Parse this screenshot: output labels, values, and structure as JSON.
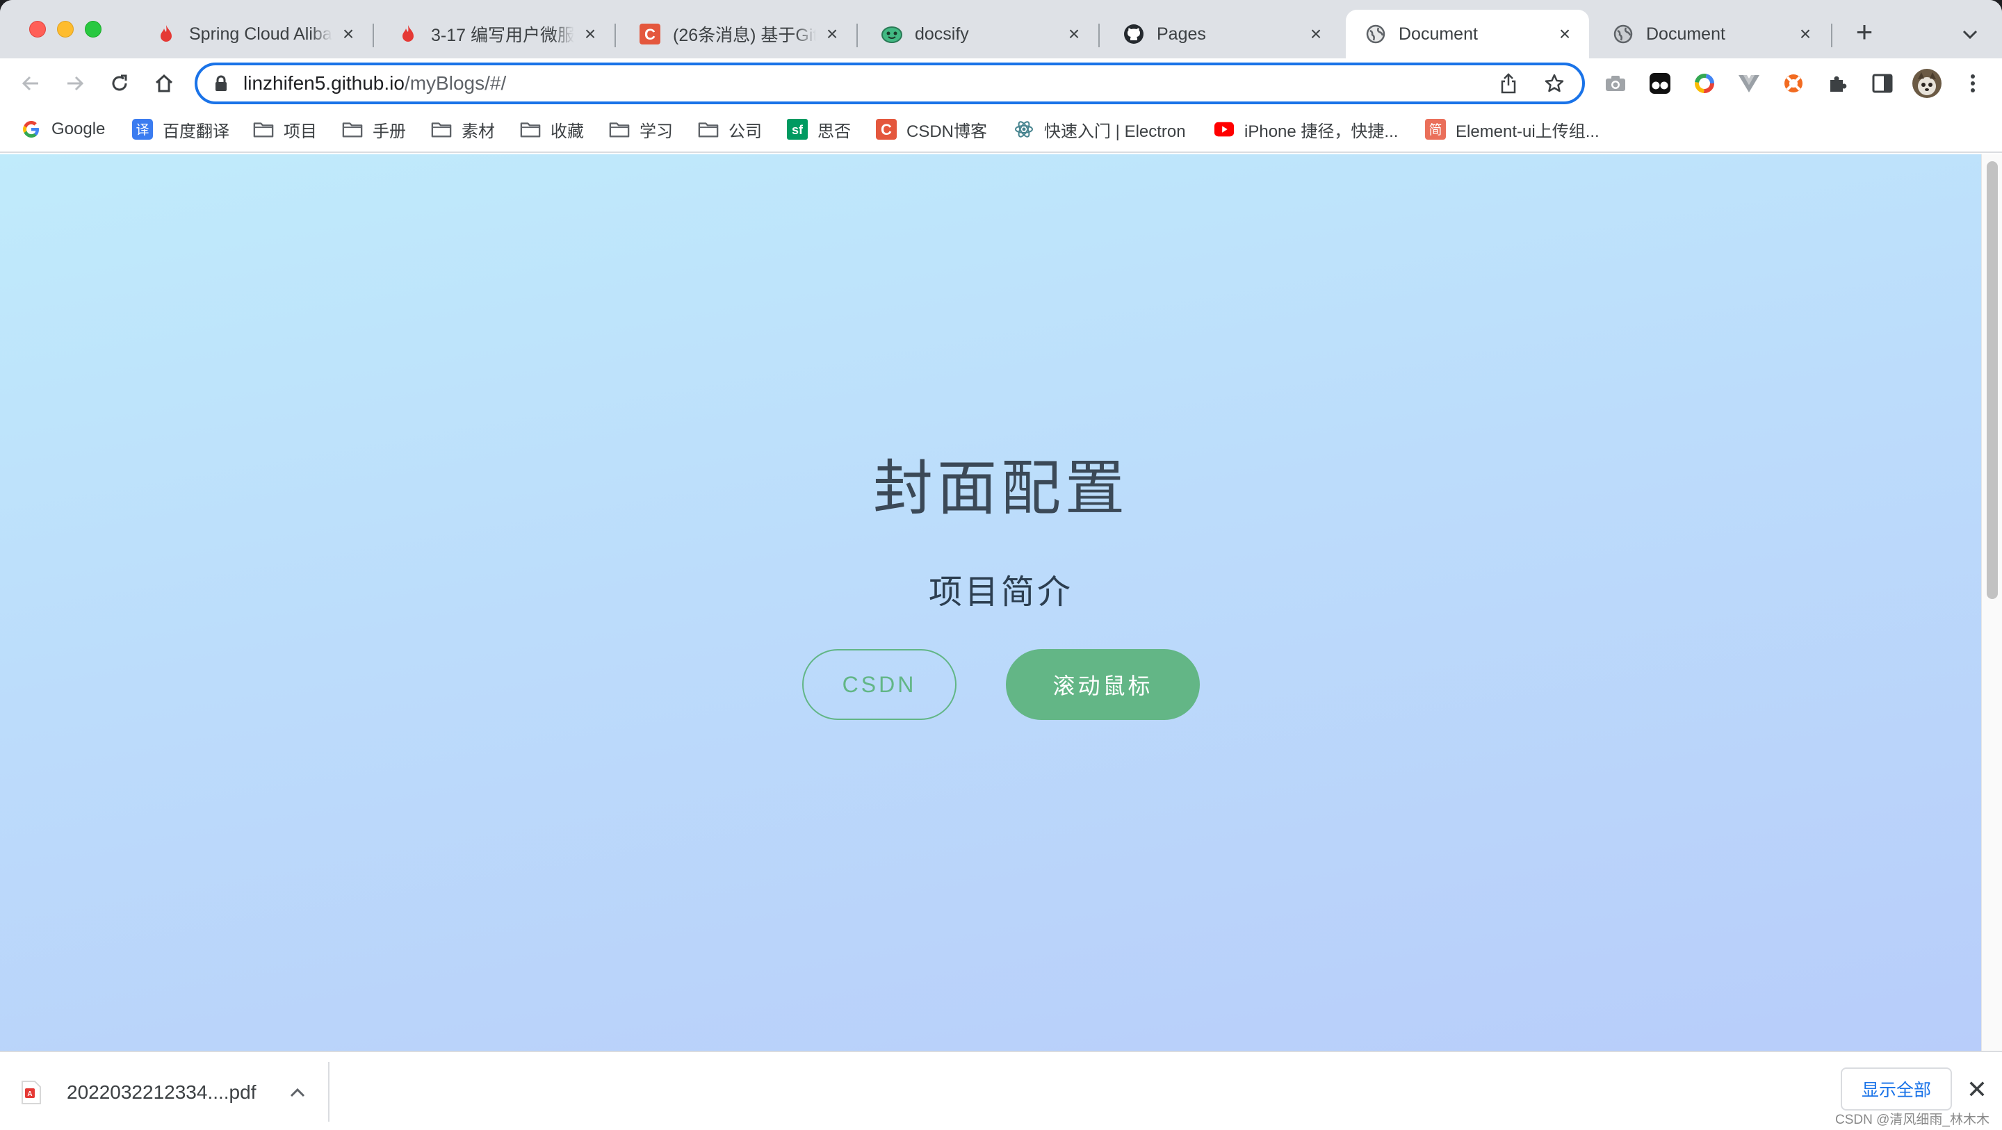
{
  "browser": {
    "tabs": [
      {
        "title": "Spring Cloud Alibaba",
        "icon": "flame-icon",
        "active": false
      },
      {
        "title": "3-17 编写用户微服务",
        "icon": "flame-icon",
        "active": false
      },
      {
        "title": "(26条消息) 基于Github",
        "icon": "csdn-icon",
        "active": false
      },
      {
        "title": "docsify",
        "icon": "docsify-icon",
        "active": false
      },
      {
        "title": "Pages",
        "icon": "github-icon",
        "active": false
      },
      {
        "title": "Document",
        "icon": "globe-icon",
        "active": true
      },
      {
        "title": "Document",
        "icon": "globe-icon",
        "active": false
      }
    ],
    "new_tab_label": "+",
    "address": {
      "host": "linzhifen5.github.io",
      "path": "/myBlogs/#/"
    },
    "bookmarks": [
      {
        "label": "Google",
        "icon": "google-icon"
      },
      {
        "label": "百度翻译",
        "icon": "translate-icon"
      },
      {
        "label": "项目",
        "icon": "folder-icon"
      },
      {
        "label": "手册",
        "icon": "folder-icon"
      },
      {
        "label": "素材",
        "icon": "folder-icon"
      },
      {
        "label": "收藏",
        "icon": "folder-icon"
      },
      {
        "label": "学习",
        "icon": "folder-icon"
      },
      {
        "label": "公司",
        "icon": "folder-icon"
      },
      {
        "label": "思否",
        "icon": "segmentfault-icon"
      },
      {
        "label": "CSDN博客",
        "icon": "csdn-icon"
      },
      {
        "label": "快速入门 | Electron",
        "icon": "electron-icon"
      },
      {
        "label": "iPhone 捷径，快捷...",
        "icon": "youtube-icon"
      },
      {
        "label": "Element-ui上传组...",
        "icon": "jianshu-icon"
      }
    ]
  },
  "cover": {
    "title": "封面配置",
    "subtitle": "项目简介",
    "buttons": {
      "csdn": "CSDN",
      "scroll": "滚动鼠标"
    }
  },
  "downloads": {
    "file_name": "2022032212334....pdf",
    "show_all": "显示全部",
    "close": "✕"
  },
  "watermark": "CSDN @清风细雨_林木木",
  "colors": {
    "accent": "#1a73e8",
    "cover_green": "#63b686",
    "cover_text": "#2c3e50"
  }
}
